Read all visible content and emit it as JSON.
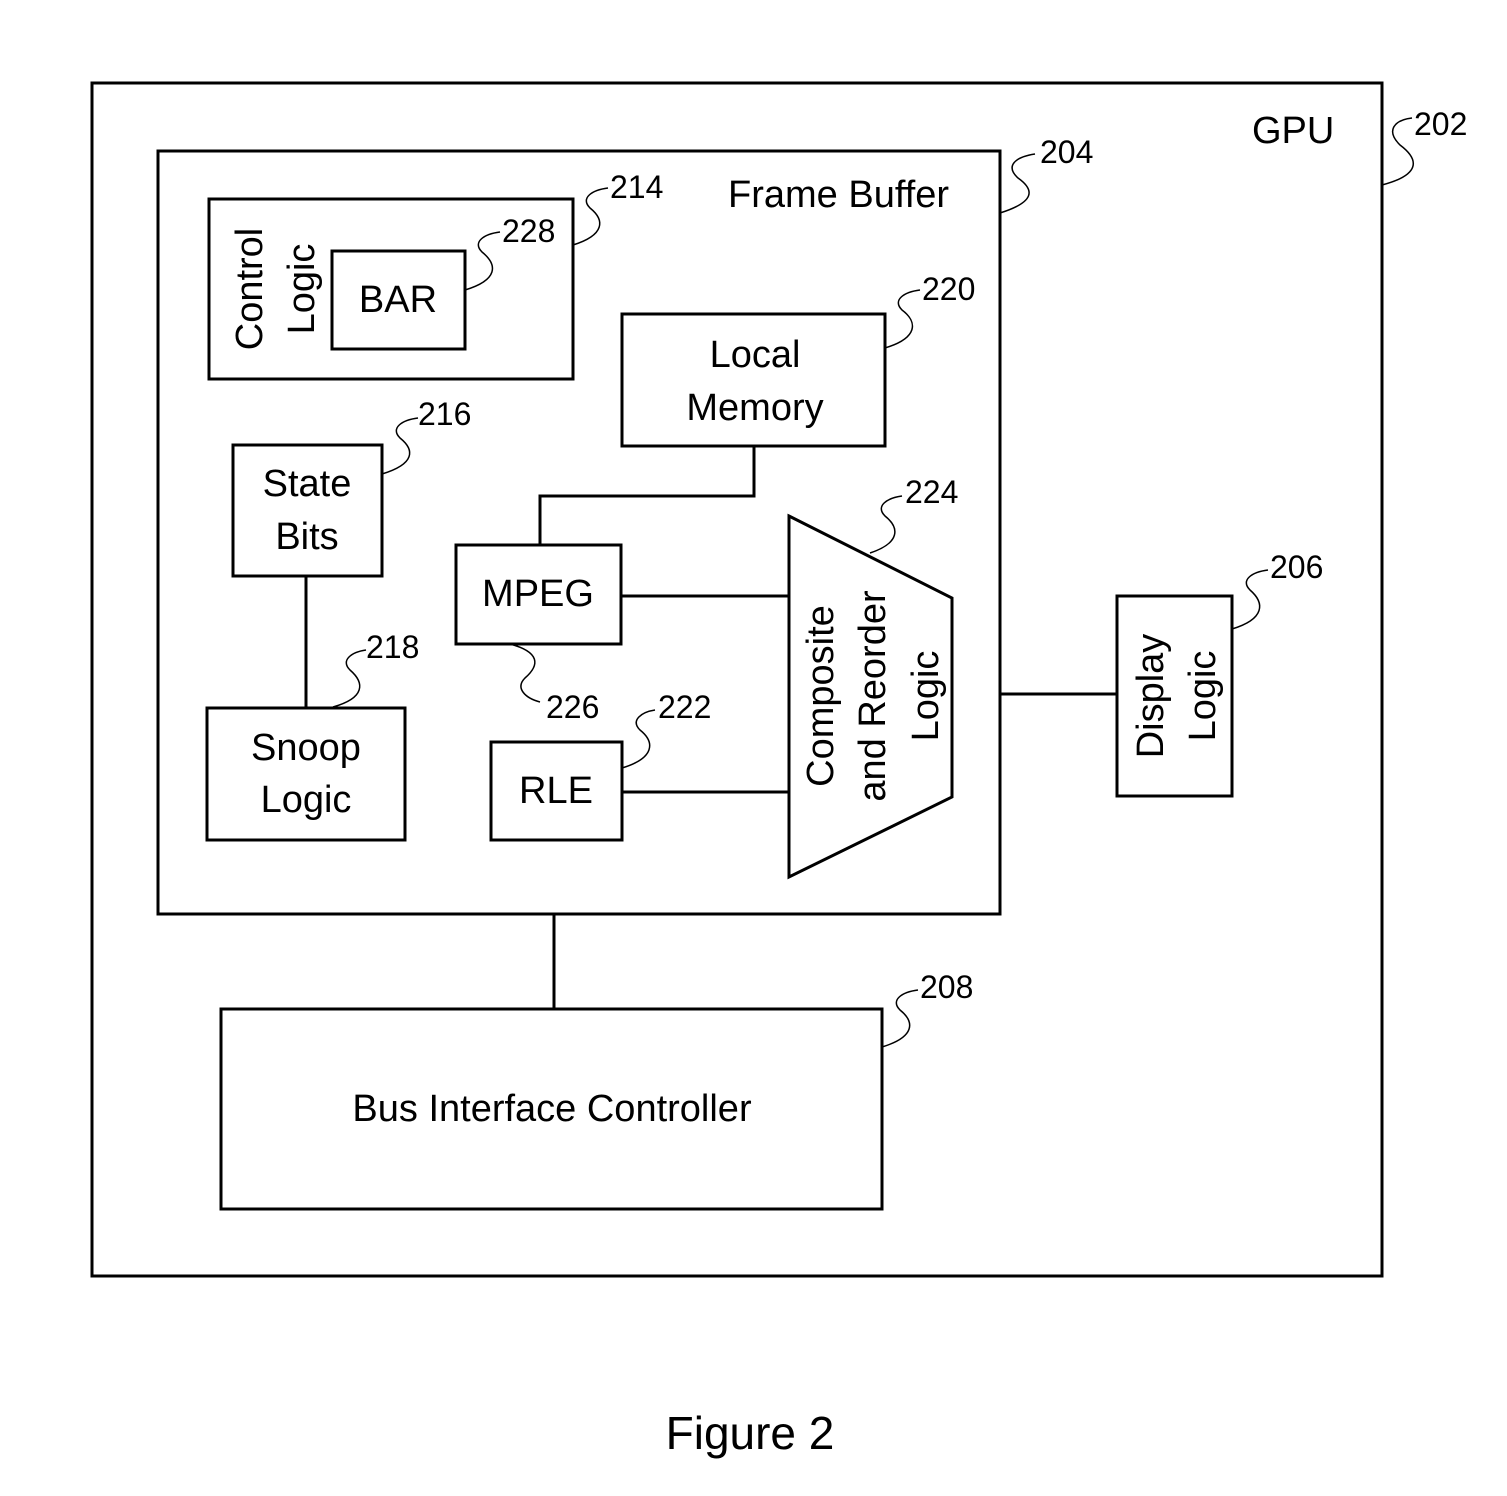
{
  "diagram": {
    "caption": "Figure 2",
    "blocks": {
      "gpu": {
        "label": "GPU",
        "ref": "202"
      },
      "frame_buffer": {
        "label": "Frame Buffer",
        "ref": "204"
      },
      "display_logic": {
        "label_lines": [
          "Display",
          "Logic"
        ],
        "ref": "206"
      },
      "bus_interface_controller": {
        "label": "Bus Interface Controller",
        "ref": "208"
      },
      "control_logic": {
        "label_lines": [
          "Control",
          "Logic"
        ],
        "ref": "214"
      },
      "bar": {
        "label": "BAR",
        "ref": "228"
      },
      "state_bits": {
        "label_lines": [
          "State",
          "Bits"
        ],
        "ref": "216"
      },
      "snoop_logic": {
        "label_lines": [
          "Snoop",
          "Logic"
        ],
        "ref": "218"
      },
      "local_memory": {
        "label_lines": [
          "Local",
          "Memory"
        ],
        "ref": "220"
      },
      "mpeg": {
        "label": "MPEG",
        "ref": "226"
      },
      "rle": {
        "label": "RLE",
        "ref": "222"
      },
      "composite_reorder_logic": {
        "label_lines": [
          "Composite",
          "and Reorder",
          "Logic"
        ],
        "ref": "224"
      }
    },
    "connections": [
      {
        "from": "Local Memory",
        "to": "MPEG"
      },
      {
        "from": "MPEG",
        "to": "Composite and Reorder Logic"
      },
      {
        "from": "RLE",
        "to": "Composite and Reorder Logic"
      },
      {
        "from": "State Bits",
        "to": "Snoop Logic"
      },
      {
        "from": "Frame Buffer",
        "to": "Display Logic"
      },
      {
        "from": "Frame Buffer",
        "to": "Bus Interface Controller"
      }
    ]
  }
}
